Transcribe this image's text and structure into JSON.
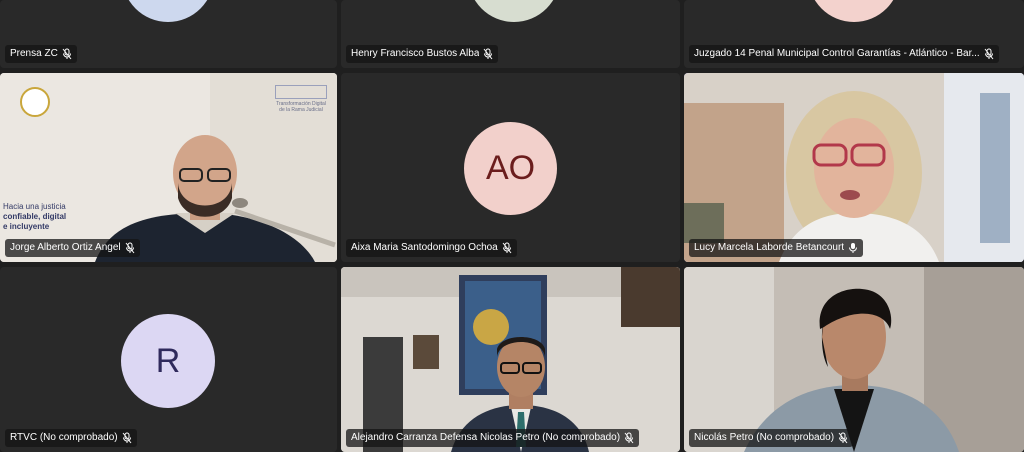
{
  "participants": [
    {
      "name": "Prensa ZC",
      "mic_icon": "mic-off-icon"
    },
    {
      "name": "Henry Francisco Bustos Alba",
      "mic_icon": "mic-off-icon"
    },
    {
      "name": "Juzgado 14 Penal Municipal Control Garantías - Atlántico - Bar...",
      "mic_icon": "mic-off-icon"
    },
    {
      "name": "Jorge Alberto Ortiz Angel",
      "mic_icon": "mic-off-icon",
      "banner_logo_text": "Transformación Digital de la Rama Judicial",
      "banner_line1": "Hacia una justicia",
      "banner_line2": "confiable, digital",
      "banner_line3": "e incluyente"
    },
    {
      "name": "Aixa Maria Santodomingo Ochoa",
      "mic_icon": "mic-off-icon",
      "initials": "AO"
    },
    {
      "name": "Lucy Marcela Laborde Betancourt",
      "mic_icon": "mic-on-icon",
      "active_speaker": true
    },
    {
      "name": "RTVC (No comprobado)",
      "mic_icon": "mic-off-icon",
      "initials": "R"
    },
    {
      "name": "Alejandro Carranza Defensa Nicolas Petro (No comprobado)",
      "mic_icon": "mic-off-icon"
    },
    {
      "name": "Nicolás Petro (No comprobado)",
      "mic_icon": "mic-off-icon"
    }
  ],
  "colors": {
    "avatar_ao_bg": "#f2d0cb",
    "avatar_ao_text": "#6b1d1d",
    "avatar_r_bg": "#dcd7f3",
    "avatar_r_text": "#2f2a5c",
    "active_outline": "#7b83eb"
  }
}
